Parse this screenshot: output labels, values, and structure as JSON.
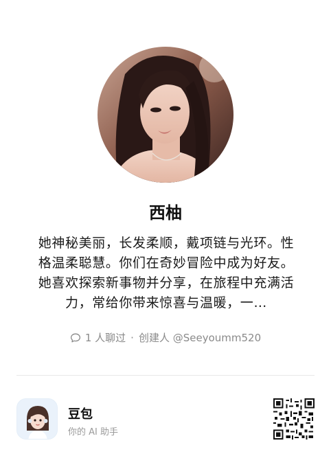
{
  "character": {
    "name": "西柚",
    "description": "她神秘美丽，长发柔顺，戴项链与光环。性格温柔聪慧。你们在奇妙冒险中成为好友。她喜欢探索新事物并分享，在旅程中充满活力，常给你带来惊喜与温暖，一…",
    "chat_count": "1 人聊过",
    "separator": "·",
    "creator": "创建人 @Seeyoumm520"
  },
  "footer": {
    "app_name": "豆包",
    "app_subtitle": "你的 AI 助手"
  },
  "icons": {
    "chat": "chat-bubble-icon",
    "app": "doubao-app-icon",
    "qr": "qr-code"
  }
}
